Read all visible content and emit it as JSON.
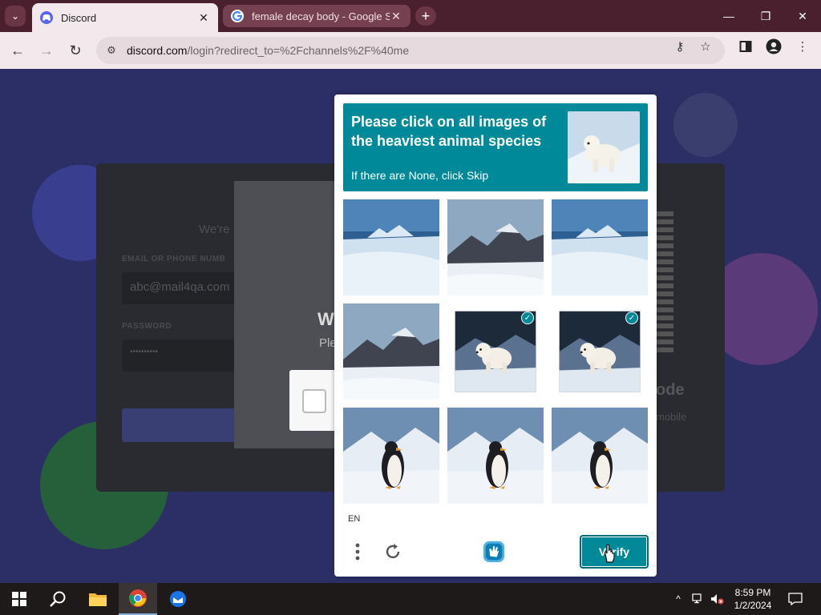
{
  "browser": {
    "tabs": [
      {
        "title": "Discord",
        "favicon": "discord-icon",
        "active": true
      },
      {
        "title": "female decay body - Google Se",
        "favicon": "google-icon",
        "active": false
      }
    ],
    "address": {
      "domain": "discord.com",
      "path": "/login?redirect_to=%2Fchannels%2F%40me"
    },
    "window_controls": {
      "minimize": "—",
      "restore": "❐",
      "close": "✕"
    }
  },
  "page": {
    "welcome_title": "W",
    "welcome_sub": "We're",
    "email_label": "EMAIL OR PHONE NUMB",
    "email_value": "abc@mail4qa.com",
    "password_label": "PASSWORD",
    "password_value": "••••••••••",
    "modal_title": "W",
    "modal_sub": "Ple",
    "qr_title": "ode",
    "qr_sub": "mobile"
  },
  "captcha": {
    "prompt_title": "Please click on all images of the heaviest animal species",
    "prompt_hint": "If there are None, click Skip",
    "language": "EN",
    "verify_label": "Verify",
    "accent_color": "#008a99",
    "images": [
      {
        "subject": "iceberg",
        "selected": false
      },
      {
        "subject": "mountain",
        "selected": false
      },
      {
        "subject": "iceberg",
        "selected": false
      },
      {
        "subject": "mountain",
        "selected": false
      },
      {
        "subject": "polar-bear",
        "selected": true
      },
      {
        "subject": "polar-bear",
        "selected": true
      },
      {
        "subject": "penguin",
        "selected": false
      },
      {
        "subject": "penguin",
        "selected": false
      },
      {
        "subject": "penguin",
        "selected": false
      }
    ]
  },
  "taskbar": {
    "time": "8:59 PM",
    "date": "1/2/2024",
    "apps": [
      "start-icon",
      "search-icon",
      "file-explorer-icon",
      "chrome-icon",
      "thunderbird-icon"
    ]
  }
}
